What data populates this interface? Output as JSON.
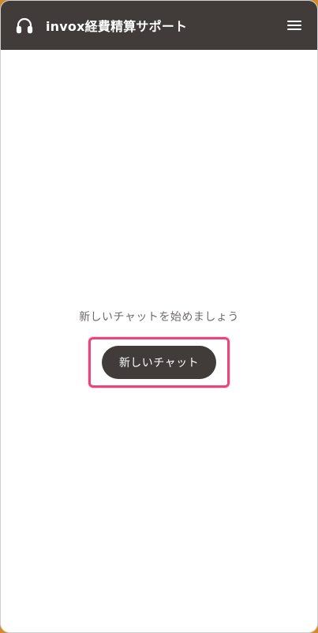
{
  "header": {
    "title": "invox経費精算サポート",
    "support_icon": "headset-icon",
    "menu_icon": "hamburger-menu-icon"
  },
  "main": {
    "prompt": "新しいチャットを始めましょう",
    "new_chat_label": "新しいチャット"
  },
  "colors": {
    "header_bg": "#413b39",
    "button_bg": "#413b39",
    "highlight": "#e8467a",
    "page_bg": "#ffffff",
    "outer_bg": "#d28a2a"
  }
}
